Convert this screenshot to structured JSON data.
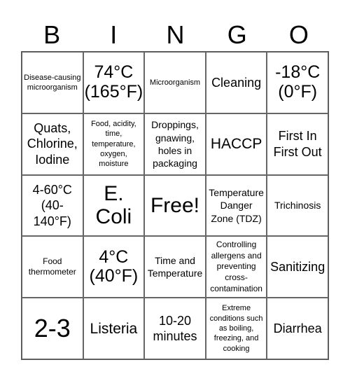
{
  "header": [
    "B",
    "I",
    "N",
    "G",
    "O"
  ],
  "cells": [
    "Disease-causing microorganism",
    "74°C (165°F)",
    "Microorganism",
    "Cleaning",
    "-18°C (0°F)",
    "Quats, Chlorine, Iodine",
    "Food, acidity, time, temperature, oxygen, moisture",
    "Droppings, gnawing, holes in packaging",
    "HACCP",
    "First In First Out",
    "4-60°C (40-140°F)",
    "E. Coli",
    "Free!",
    "Temperature Danger Zone (TDZ)",
    "Trichinosis",
    "Food thermometer",
    "4°C (40°F)",
    "Time and Temperature",
    "Controlling allergens and preventing cross-contamination",
    "Sanitizing",
    "2-3",
    "Listeria",
    "10-20 minutes",
    "Extreme conditions such as boiling, freezing, and cooking",
    "Diarrhea"
  ]
}
